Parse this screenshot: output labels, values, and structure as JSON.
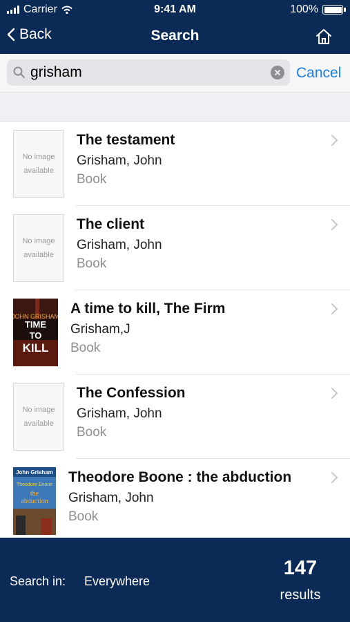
{
  "status_bar": {
    "carrier": "Carrier",
    "time": "9:41 AM",
    "battery": "100%"
  },
  "nav": {
    "back_label": "Back",
    "title": "Search"
  },
  "search": {
    "value": "grisham",
    "cancel_label": "Cancel"
  },
  "no_image": {
    "line1": "No image",
    "line2": "available"
  },
  "results": [
    {
      "title": "The testament",
      "author": "Grisham, John",
      "type": "Book",
      "thumbnail": "no-image"
    },
    {
      "title": "The client",
      "author": "Grisham, John",
      "type": "Book",
      "thumbnail": "no-image"
    },
    {
      "title": "A time to kill, The Firm",
      "author": "Grisham,J",
      "type": "Book",
      "thumbnail": "cover",
      "cover_text": {
        "author": "JOHN GRISHAM",
        "title1": "TIME",
        "title2": "TO",
        "title3": "KILL"
      }
    },
    {
      "title": "The Confession",
      "author": "Grisham, John",
      "type": "Book",
      "thumbnail": "no-image"
    },
    {
      "title": "Theodore Boone : the abduction",
      "author": "Grisham, John",
      "type": "Book",
      "thumbnail": "cover",
      "cover_text": {
        "author": "John Grisham",
        "series": "Theodore Boone",
        "title1": "the",
        "title2": "abduction"
      }
    }
  ],
  "footer": {
    "search_in_label": "Search in:",
    "search_in_value": "Everywhere",
    "count": "147",
    "count_label": "results"
  },
  "colors": {
    "nav_bg": "#0b2a55",
    "accent": "#1a7ee3"
  }
}
